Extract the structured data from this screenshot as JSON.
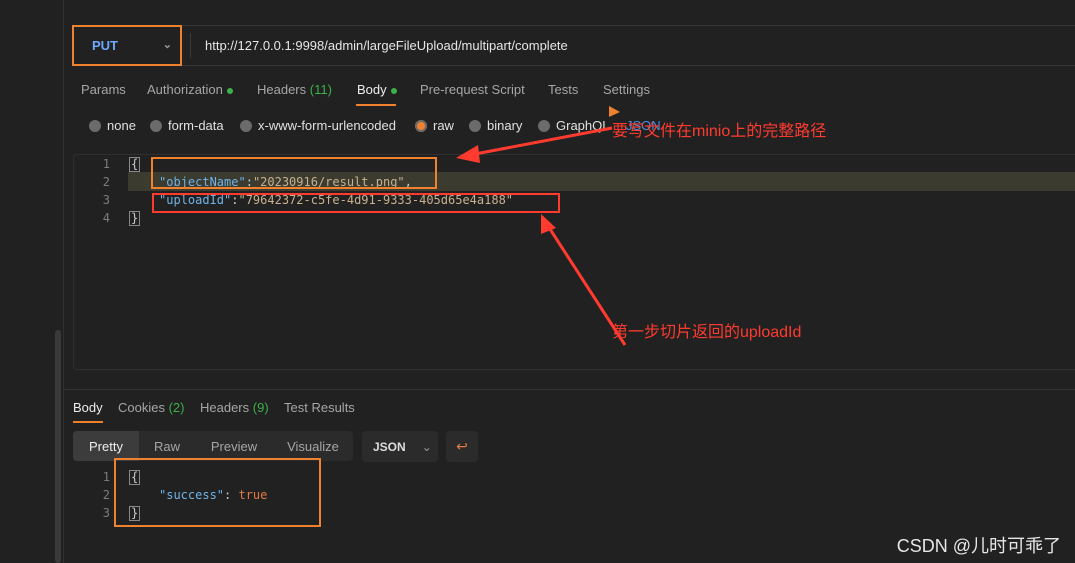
{
  "request": {
    "method": "PUT",
    "url": "http://127.0.0.1:9998/admin/largeFileUpload/multipart/complete"
  },
  "tabs": [
    {
      "label": "Params"
    },
    {
      "label": "Authorization"
    },
    {
      "label": "Headers",
      "count": "(11)"
    },
    {
      "label": "Body"
    },
    {
      "label": "Pre-request Script"
    },
    {
      "label": "Tests"
    },
    {
      "label": "Settings"
    }
  ],
  "body_types": [
    "none",
    "form-data",
    "x-www-form-urlencoded",
    "raw",
    "binary",
    "GraphQL",
    "JSON"
  ],
  "body_type_selected": "raw",
  "editor": {
    "line_numbers": [
      "1",
      "2",
      "3",
      "4"
    ],
    "open": "{",
    "close": "}",
    "k1": "\"objectName\"",
    "v1": "\"20230916/result.png\"",
    "k2": "\"uploadId\"",
    "v2": "\"79642372-c5fe-4d91-9333-405d65e4a188\""
  },
  "response": {
    "tabs": [
      {
        "label": "Body"
      },
      {
        "label": "Cookies",
        "count": "(2)"
      },
      {
        "label": "Headers",
        "count": "(9)"
      },
      {
        "label": "Test Results"
      }
    ],
    "views": [
      "Pretty",
      "Raw",
      "Preview",
      "Visualize"
    ],
    "format": "JSON",
    "line_numbers": [
      "1",
      "2",
      "3"
    ],
    "key": "\"success\"",
    "value": "true"
  },
  "annotations": {
    "object_name": "要写文件在minio上的完整路径",
    "upload_id": "第一步切片返回的uploadId"
  },
  "watermark": "CSDN @儿时可乖了",
  "colors": {
    "accent": "#f0812e",
    "annotation": "#ff3b30",
    "green": "#3cb04a"
  }
}
